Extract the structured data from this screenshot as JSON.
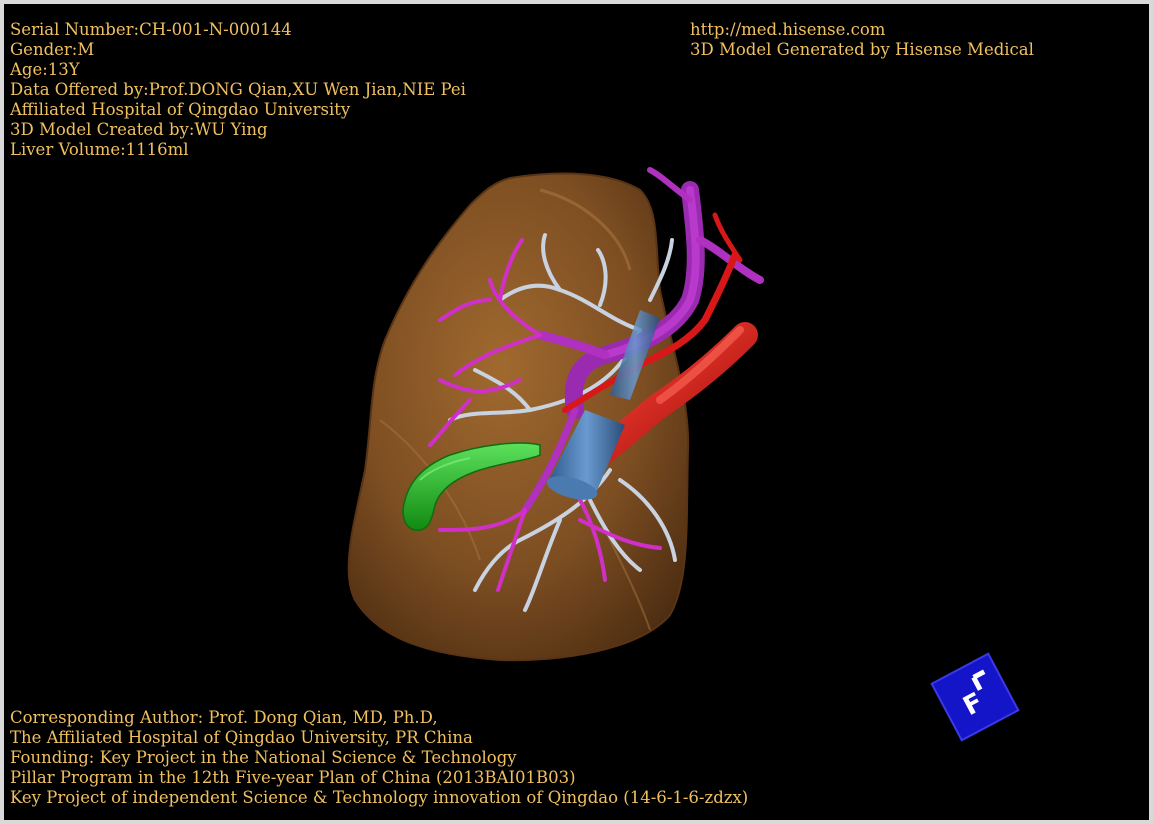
{
  "colors": {
    "text": "#f0c060",
    "background": "#000000",
    "frame": "#d9d9d9",
    "liver": "#8b5a2b",
    "portal_vein": "#b030c0",
    "hepatic_vein": "#c8d2e0",
    "artery": "#d01818",
    "gallbladder": "#28b428",
    "ivc": "#3c6aa0",
    "orientation_cube": "#1414c8"
  },
  "top_left": {
    "serial_number": "Serial Number:CH-001-N-000144",
    "gender": "Gender:M",
    "age": "Age:13Y",
    "data_offered": "Data Offered by:Prof.DONG Qian,XU Wen Jian,NIE Pei",
    "hospital": "Affiliated Hospital of Qingdao University",
    "model_created": "3D Model Created by:WU Ying",
    "liver_volume": "Liver Volume:1116ml"
  },
  "top_right": {
    "url": "http://med.hisense.com",
    "generated_by": "3D Model Generated by Hisense Medical"
  },
  "bottom_left": {
    "author": "Corresponding Author: Prof. Dong Qian, MD, Ph.D,",
    "affiliation": "The Affiliated Hospital of Qingdao University, PR China",
    "founding": "Founding: Key Project in the National Science & Technology",
    "pillar": "Pillar Program in the 12th Five-year Plan of China (2013BAI01B03)",
    "key_project": "Key Project of independent Science & Technology innovation of Qingdao (14-6-1-6-zdzx)"
  },
  "orientation_cube": {
    "face_label": "F"
  },
  "icons": {
    "cube": "orientation-cube-icon"
  }
}
